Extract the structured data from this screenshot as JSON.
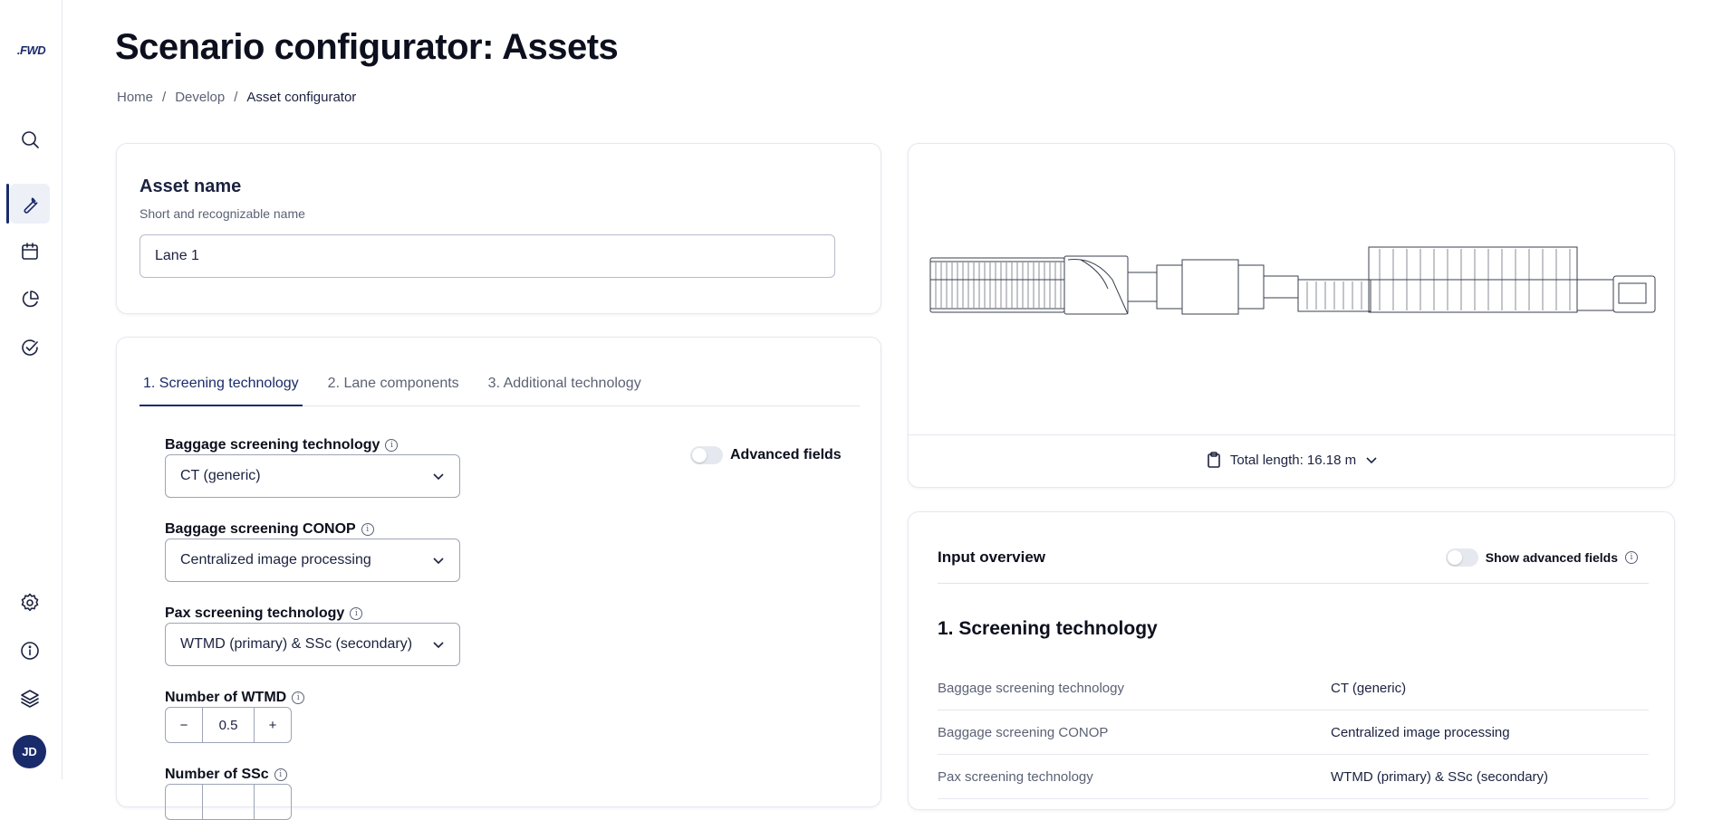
{
  "app": {
    "logo": ".FWD"
  },
  "sidebar": {
    "items": [
      {
        "name": "search",
        "icon": "search-icon"
      },
      {
        "name": "develop",
        "icon": "wrench-icon",
        "active": true
      },
      {
        "name": "calendar",
        "icon": "calendar-icon"
      },
      {
        "name": "analytics",
        "icon": "pie-chart-icon"
      },
      {
        "name": "validate",
        "icon": "check-circle-icon"
      },
      {
        "name": "settings",
        "icon": "gear-icon"
      },
      {
        "name": "info",
        "icon": "info-icon"
      },
      {
        "name": "layers",
        "icon": "layers-icon"
      }
    ],
    "avatar": "JD"
  },
  "header": {
    "title": "Scenario configurator: Assets",
    "breadcrumb": [
      "Home",
      "/",
      "Develop",
      "/",
      "Asset configurator"
    ]
  },
  "asset": {
    "title": "Asset name",
    "subtitle": "Short and recognizable name",
    "value": "Lane 1"
  },
  "config": {
    "tabs": [
      "1. Screening technology",
      "2. Lane components",
      "3. Additional technology"
    ],
    "advanced_label": "Advanced fields",
    "fields": {
      "baggage_tech_label": "Baggage screening technology",
      "baggage_tech_value": "CT (generic)",
      "conop_label": "Baggage screening CONOP",
      "conop_value": "Centralized image processing",
      "pax_label": "Pax screening technology",
      "pax_value": "WTMD (primary) & SSc (secondary)",
      "wtmd_label": "Number of WTMD",
      "wtmd_value": "0.5",
      "ssc_label": "Number of SSc",
      "minus": "−",
      "plus": "+"
    }
  },
  "preview": {
    "total_length": "Total length: 16.18 m"
  },
  "overview": {
    "title": "Input overview",
    "toggle_label": "Show advanced fields",
    "section": "1. Screening technology",
    "rows": [
      {
        "k": "Baggage screening technology",
        "v": "CT (generic)"
      },
      {
        "k": "Baggage screening CONOP",
        "v": "Centralized image processing"
      },
      {
        "k": "Pax screening technology",
        "v": "WTMD (primary) & SSc (secondary)"
      }
    ]
  },
  "colors": {
    "accent": "#1a2b6b",
    "text": "#1b2240",
    "muted": "#5b6275",
    "border": "#e6e8ef"
  }
}
